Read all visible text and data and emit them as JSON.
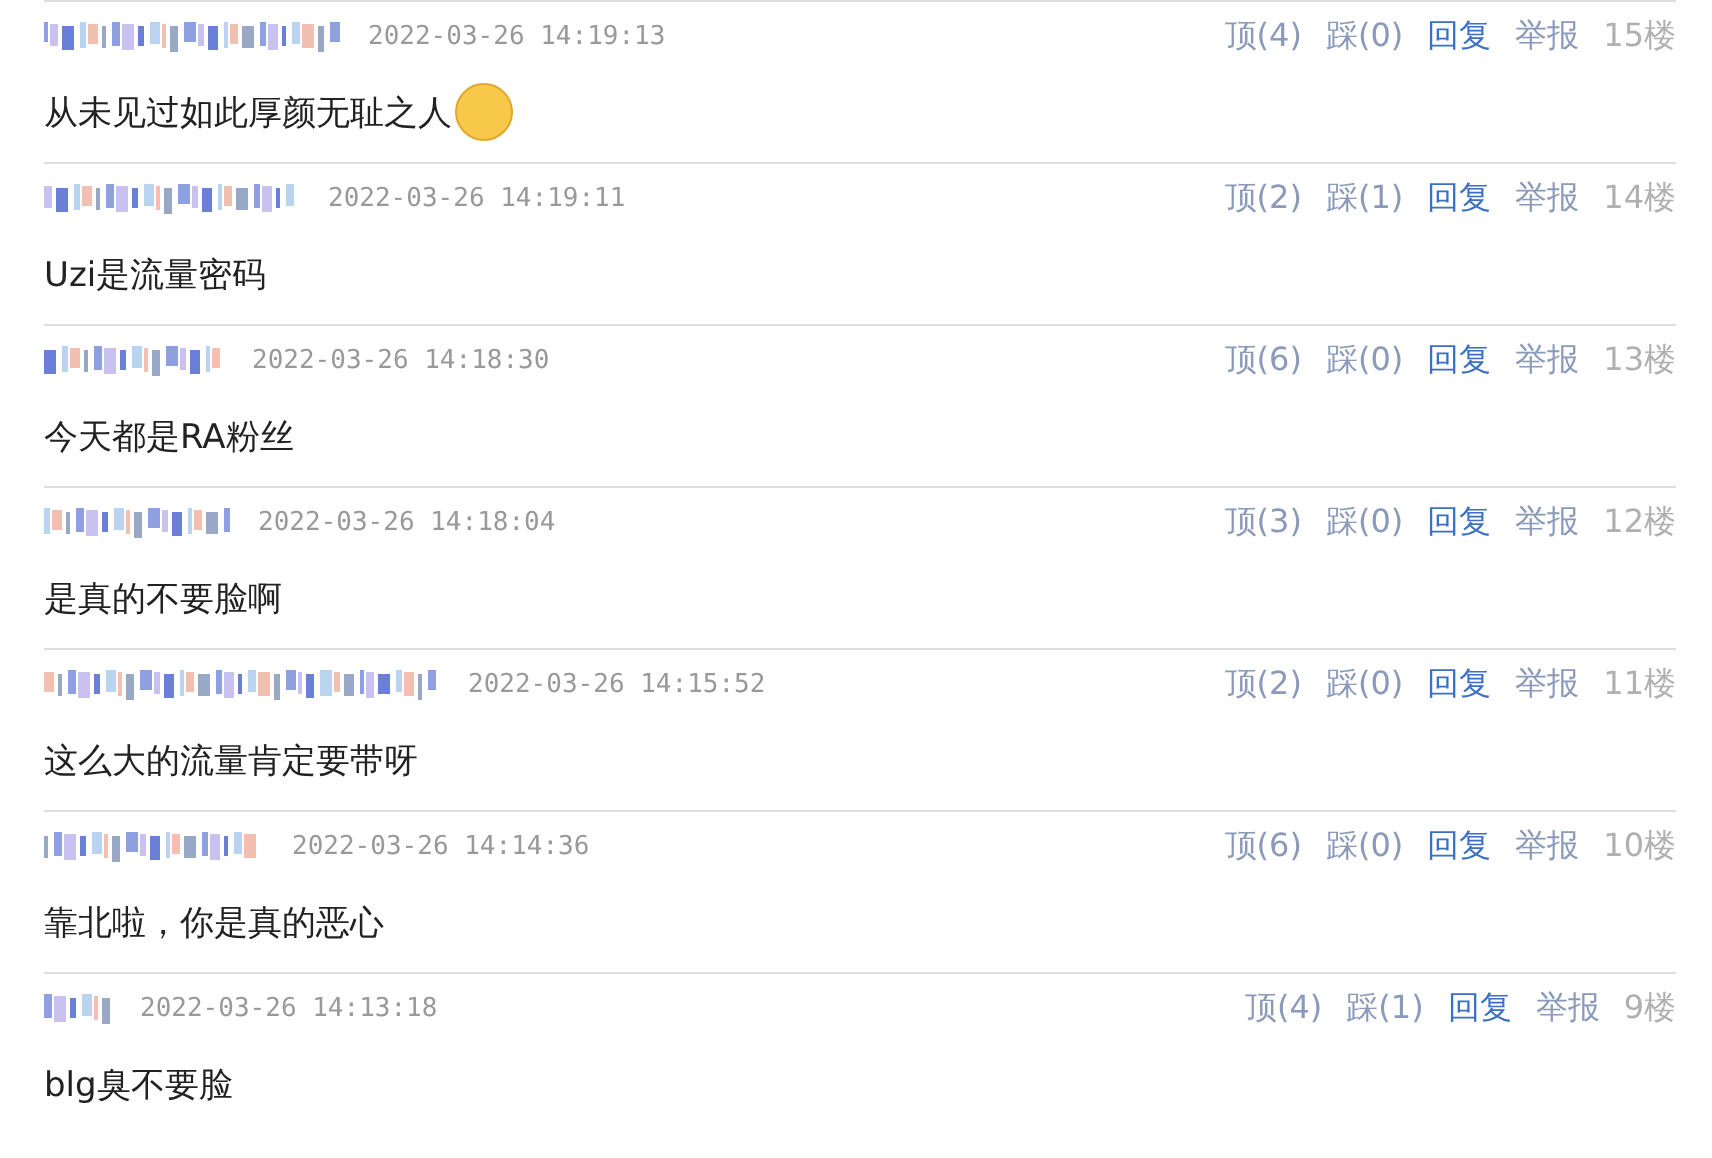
{
  "comments": [
    {
      "time": "2022-03-26 14:19:13",
      "up": "顶(4)",
      "down": "踩(0)",
      "reply": "回复",
      "report": "举报",
      "floor": "15楼",
      "text": "从未见过如此厚颜无耻之人",
      "emoji": true
    },
    {
      "time": "2022-03-26 14:19:11",
      "up": "顶(2)",
      "down": "踩(1)",
      "reply": "回复",
      "report": "举报",
      "floor": "14楼",
      "text": "Uzi是流量密码",
      "emoji": false
    },
    {
      "time": "2022-03-26 14:18:30",
      "up": "顶(6)",
      "down": "踩(0)",
      "reply": "回复",
      "report": "举报",
      "floor": "13楼",
      "text": "今天都是RA粉丝",
      "emoji": false
    },
    {
      "time": "2022-03-26 14:18:04",
      "up": "顶(3)",
      "down": "踩(0)",
      "reply": "回复",
      "report": "举报",
      "floor": "12楼",
      "text": "是真的不要脸啊",
      "emoji": false
    },
    {
      "time": "2022-03-26 14:15:52",
      "up": "顶(2)",
      "down": "踩(0)",
      "reply": "回复",
      "report": "举报",
      "floor": "11楼",
      "text": "这么大的流量肯定要带呀",
      "emoji": false
    },
    {
      "time": "2022-03-26 14:14:36",
      "up": "顶(6)",
      "down": "踩(0)",
      "reply": "回复",
      "report": "举报",
      "floor": "10楼",
      "text": "靠北啦，你是真的恶心",
      "emoji": false
    },
    {
      "time": "2022-03-26 14:13:18",
      "up": "顶(4)",
      "down": "踩(1)",
      "reply": "回复",
      "report": "举报",
      "floor": "9楼",
      "text": "blg臭不要脸",
      "emoji": false
    }
  ]
}
